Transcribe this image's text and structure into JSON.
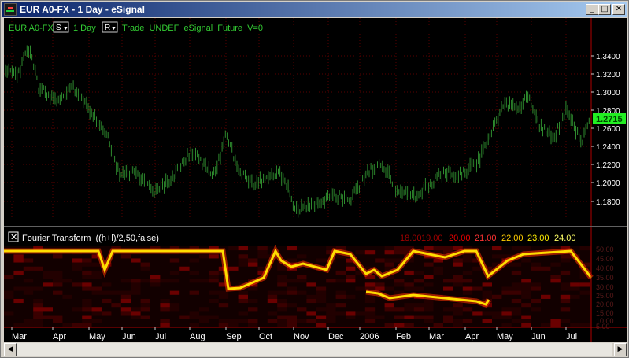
{
  "window": {
    "title": "EUR A0-FX - 1 Day - eSignal",
    "buttons": [
      "_",
      "□",
      "✕"
    ]
  },
  "price_pane": {
    "symbol": "EUR A0-FX",
    "s_toggle": "S",
    "interval": "1 Day",
    "r_toggle": "R",
    "mode_text": "Trade  UNDEF  eSignal  Future  V=0",
    "price_badge": "1.2715",
    "y_ticks": [
      "1.3400",
      "1.3200",
      "1.3000",
      "1.2800",
      "1.2600",
      "1.2400",
      "1.2200",
      "1.2000",
      "1.1800"
    ],
    "colors": {
      "bars": "#2e8b2e",
      "text": "#33cc33",
      "grid": "#8a0000",
      "badge_bg": "#22ee22"
    }
  },
  "study_pane": {
    "close_icon": "close-icon",
    "title": "Fourier Transform  ((h+l)/2,50,false)",
    "period_labels": [
      "18.00",
      "19.00",
      "20.00",
      "21.00",
      "22.00",
      "23.00",
      "24.00"
    ],
    "period_colors": [
      "#a00000",
      "#a00000",
      "#ee0000",
      "#ff3333",
      "#ffcc00",
      "#ffee00",
      "#ffff66"
    ],
    "y_ticks": [
      "50.00",
      "45.00",
      "40.00",
      "35.00",
      "30.00",
      "25.00",
      "20.00",
      "15.00",
      "10.00",
      "5.00"
    ]
  },
  "x_axis": {
    "labels": [
      "Mar",
      "Apr",
      "May",
      "Jun",
      "Jul",
      "Aug",
      "Sep",
      "Oct",
      "Nov",
      "Dec",
      "2006",
      "Feb",
      "Mar",
      "Apr",
      "May",
      "Jun",
      "Jul"
    ]
  },
  "scrollbar": {
    "left_arrow": "◀",
    "right_arrow": "▶"
  }
}
